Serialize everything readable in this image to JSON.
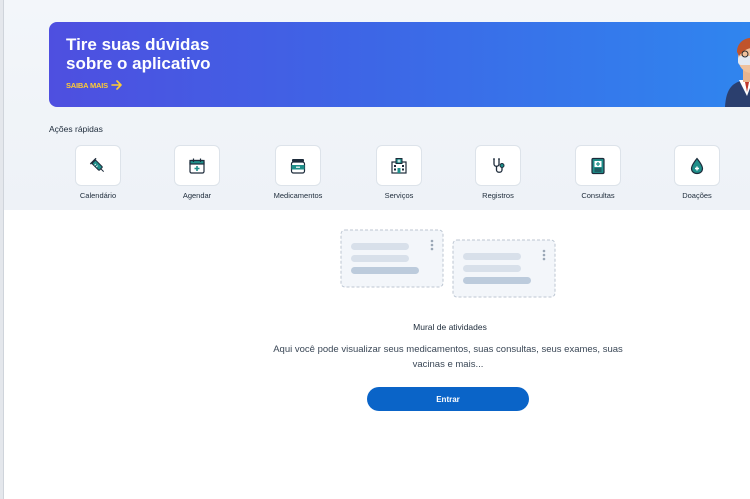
{
  "banner": {
    "title_line1": "Tire suas dúvidas",
    "title_line2": "sobre o aplicativo",
    "link_label": "SAIBA MAIS",
    "link_icon": "arrow-right-icon",
    "gradient_start": "#4e4fe0",
    "gradient_end": "#2f86ef",
    "link_color": "#ffcc33"
  },
  "quick_actions": {
    "title": "Ações rápidas",
    "items": [
      {
        "label": "Calendário",
        "icon": "syringe-icon"
      },
      {
        "label": "Agendar",
        "icon": "calendar-plus-icon"
      },
      {
        "label": "Medicamentos",
        "icon": "pill-jar-icon"
      },
      {
        "label": "Serviços",
        "icon": "hospital-icon"
      },
      {
        "label": "Registros",
        "icon": "stethoscope-icon"
      },
      {
        "label": "Consultas",
        "icon": "medical-record-icon"
      },
      {
        "label": "Doações",
        "icon": "blood-drop-icon"
      }
    ]
  },
  "mural": {
    "title": "Mural de atividades",
    "description": "Aqui você pode visualizar seus medicamentos, suas consultas, seus exames, suas vacinas e mais...",
    "button_label": "Entrar",
    "button_color": "#0a64c8"
  }
}
